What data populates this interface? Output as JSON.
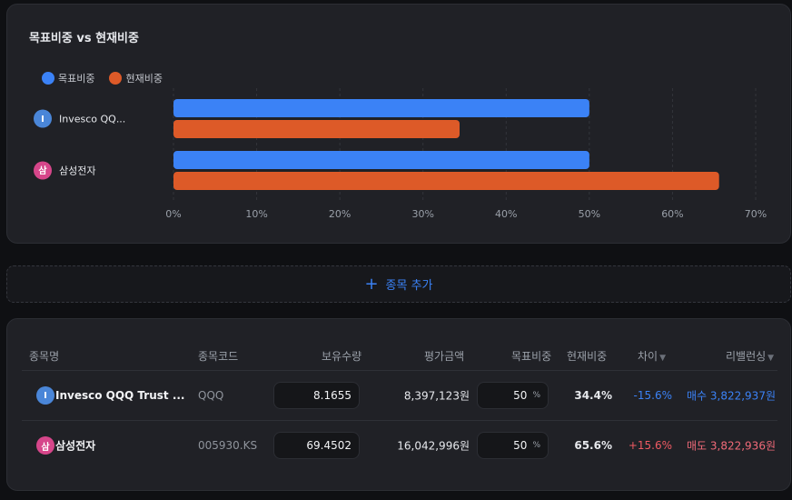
{
  "chart_data": {
    "type": "bar",
    "orientation": "horizontal",
    "title": "목표비중 vs 현재비중",
    "categories": [
      "Invesco QQ...",
      "삼성전자"
    ],
    "category_icons": [
      "I",
      "삼"
    ],
    "category_icon_colors": [
      "#4a86d8",
      "#d6468a"
    ],
    "series": [
      {
        "name": "목표비중",
        "values": [
          50,
          50
        ],
        "color": "#3b82f6"
      },
      {
        "name": "현재비중",
        "values": [
          34.4,
          65.6
        ],
        "color": "#dd5a28"
      }
    ],
    "xlim": [
      0,
      70
    ],
    "xticks": [
      "0%",
      "10%",
      "20%",
      "30%",
      "40%",
      "50%",
      "60%",
      "70%"
    ],
    "grid": true,
    "legend_position": "top-left"
  },
  "add_button": {
    "icon": "plus-icon",
    "label": "종목 추가"
  },
  "table": {
    "headers": {
      "name": "종목명",
      "code": "종목코드",
      "qty": "보유수량",
      "value": "평가금액",
      "target": "목표비중",
      "current": "현재비중",
      "diff": "차이",
      "rebalance": "리밸런싱"
    },
    "rows": [
      {
        "icon": "I",
        "icon_color": "#4a86d8",
        "name": "Invesco QQQ Trust ...",
        "code": "QQQ",
        "qty": "8.1655",
        "value": "8,397,123원",
        "target": "50",
        "target_unit": "%",
        "current": "34.4%",
        "diff": "-15.6%",
        "rebalance": "매수 3,822,937원"
      },
      {
        "icon": "삼",
        "icon_color": "#d6468a",
        "name": "삼성전자",
        "code": "005930.KS",
        "qty": "69.4502",
        "value": "16,042,996원",
        "target": "50",
        "target_unit": "%",
        "current": "65.6%",
        "diff": "+15.6%",
        "rebalance": "매도 3,822,936원"
      }
    ]
  }
}
